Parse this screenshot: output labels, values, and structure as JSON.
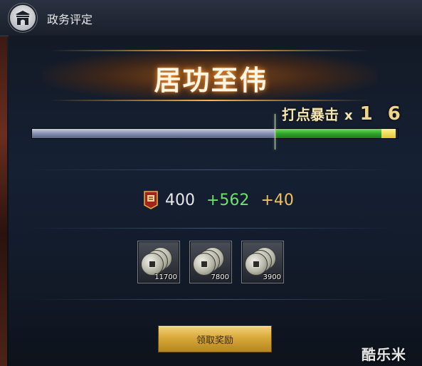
{
  "window": {
    "title": "政务评定",
    "icon": "palace-gate-icon"
  },
  "rank": {
    "title": "居功至伟"
  },
  "crit": {
    "label": "打点暴击",
    "x": "x",
    "value": "1 6"
  },
  "progress": {
    "old_fraction": 0.665,
    "new_fraction": 0.955,
    "tip_fraction": 0.995,
    "colors": {
      "old": "#8690b0",
      "new": "#2fa52a",
      "tip": "#e0c53a"
    }
  },
  "score": {
    "badge_icon": "red-banner-badge-icon",
    "base": "400",
    "plus_green": "+562",
    "plus_gold": "+40"
  },
  "rewards": [
    {
      "icon": "copper-coin-stack-icon",
      "count": "11700"
    },
    {
      "icon": "copper-coin-stack-icon",
      "count": "7800"
    },
    {
      "icon": "copper-coin-stack-icon",
      "count": "3900"
    }
  ],
  "buttons": {
    "claim_label": "领取奖励"
  },
  "watermark": "酷乐米"
}
